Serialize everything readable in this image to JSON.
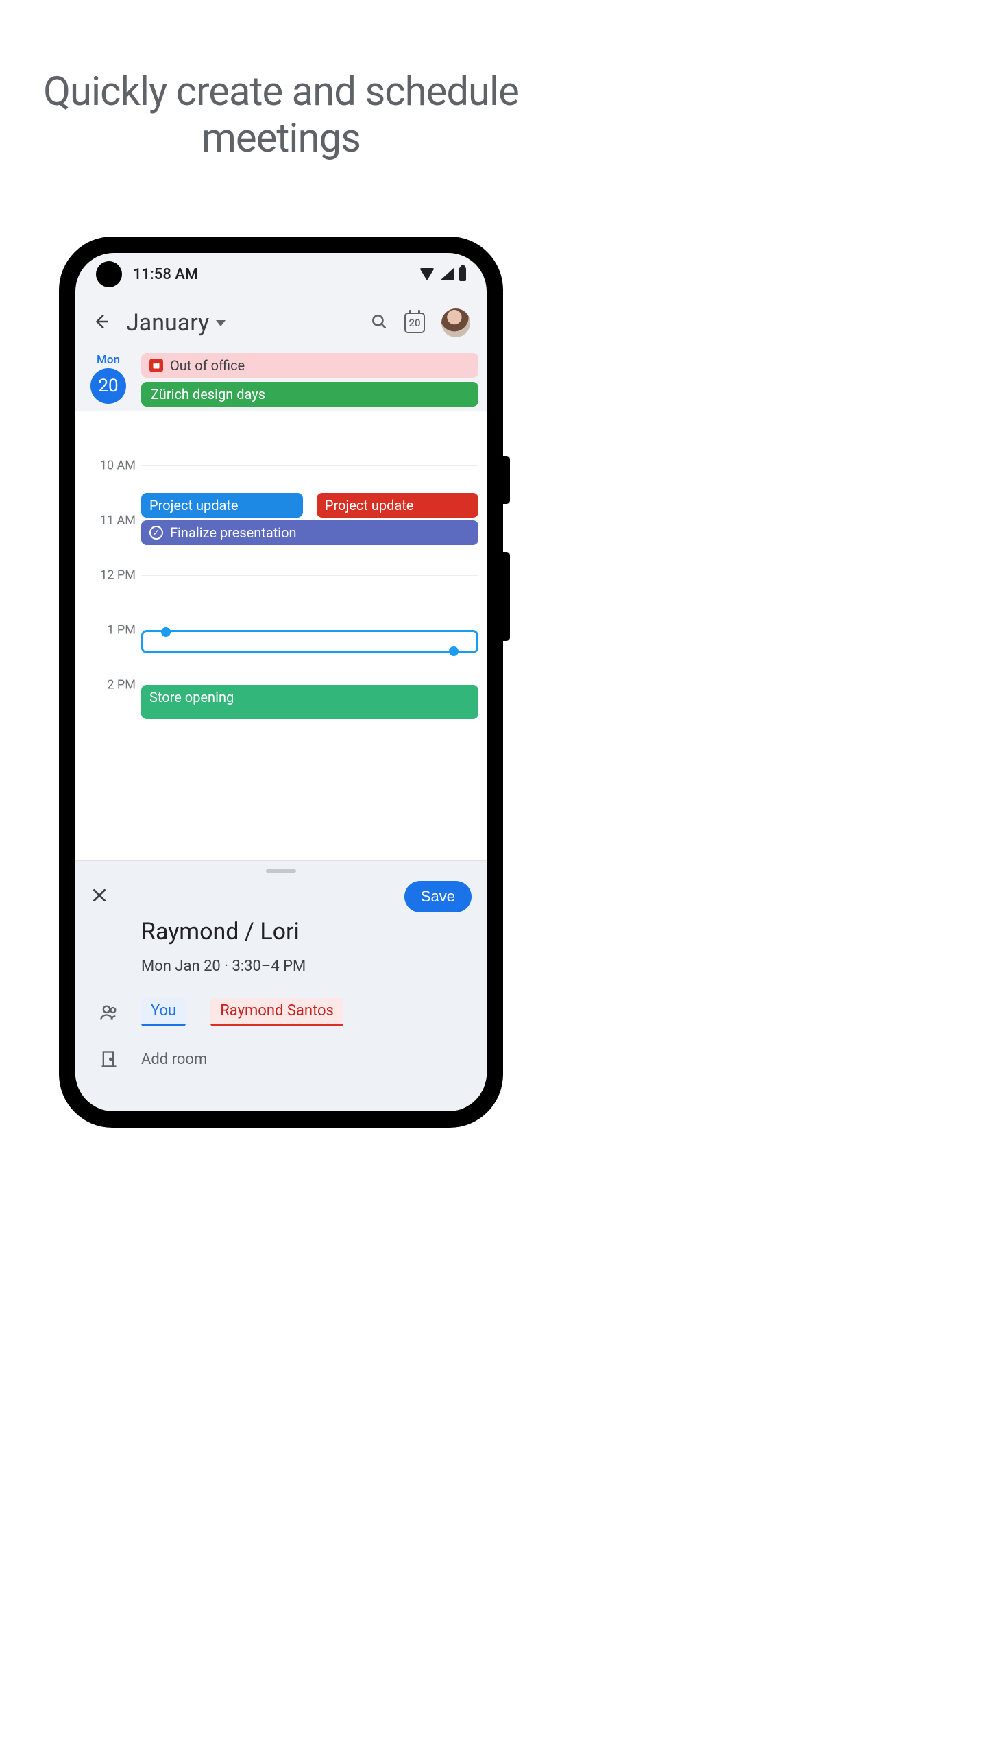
{
  "headline": "Quickly create and schedule meetings",
  "status": {
    "time": "11:58 AM"
  },
  "header": {
    "month": "January",
    "today_badge": "20"
  },
  "day": {
    "dow": "Mon",
    "date": "20"
  },
  "allday": {
    "ooo": "Out of office",
    "zurich": "Zürich design days"
  },
  "hours": {
    "h10": "10 AM",
    "h11": "11 AM",
    "h12": "12 PM",
    "h13": "1 PM",
    "h14": "2 PM"
  },
  "events": {
    "proj1": "Project update",
    "proj2": "Project update",
    "finalize": "Finalize presentation",
    "store": "Store opening"
  },
  "sheet": {
    "save": "Save",
    "title": "Raymond / Lori",
    "when": "Mon Jan 20  ·  3:30–4 PM",
    "you": "You",
    "guest": "Raymond Santos",
    "add_room": "Add room"
  }
}
